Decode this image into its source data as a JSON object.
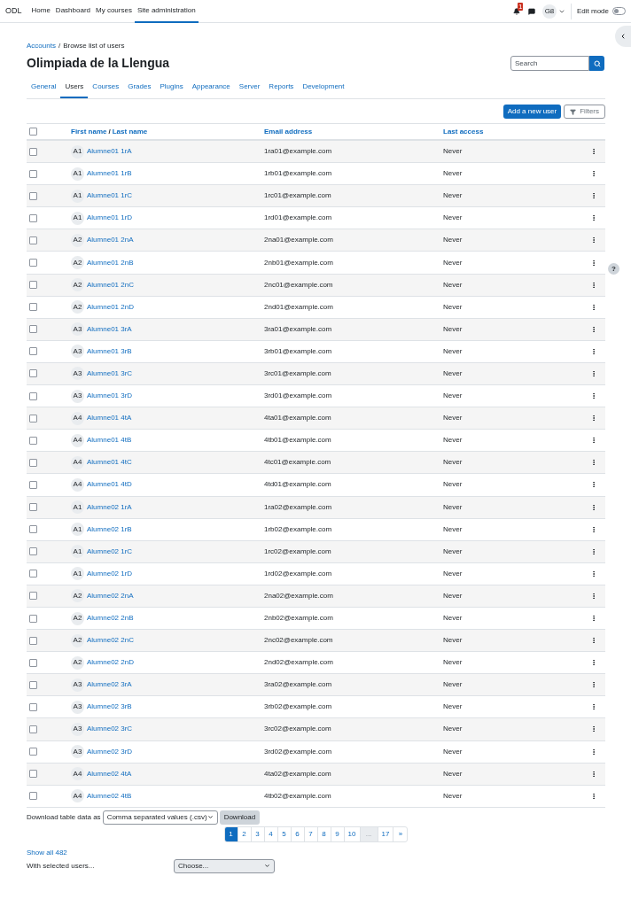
{
  "navbar": {
    "brand": "ODL",
    "links": [
      {
        "label": "Home",
        "selected": false
      },
      {
        "label": "Dashboard",
        "selected": false
      },
      {
        "label": "My courses",
        "selected": false
      },
      {
        "label": "Site administration",
        "selected": true
      }
    ],
    "notification_count": "1",
    "user_initials": "G8",
    "edit_mode": {
      "label": "Edit mode",
      "on": false
    }
  },
  "breadcrumb": [
    {
      "label": "Accounts",
      "kind": "link"
    },
    {
      "label": "/",
      "kind": "separator"
    },
    {
      "label": "Browse list of users",
      "kind": "current"
    }
  ],
  "help": "?",
  "title": "Olimpiada de la Llengua",
  "search": {
    "placeholder": "Search"
  },
  "tabs": [
    {
      "label": "General",
      "selected": false
    },
    {
      "label": "Users",
      "selected": true
    },
    {
      "label": "Courses",
      "selected": false
    },
    {
      "label": "Grades",
      "selected": false
    },
    {
      "label": "Plugins",
      "selected": false
    },
    {
      "label": "Appearance",
      "selected": false
    },
    {
      "label": "Server",
      "selected": false
    },
    {
      "label": "Reports",
      "selected": false
    },
    {
      "label": "Development",
      "selected": false
    }
  ],
  "actions": {
    "add_user": "Add a new user",
    "filters": "Filters"
  },
  "table": {
    "select_all_checked": false,
    "columns": {
      "first_name": "First name",
      "name_separator": "/",
      "last_name": "Last name",
      "email": "Email address",
      "last_access": "Last access"
    },
    "rows": [
      {
        "avatar": "A1",
        "name": "Alumne01 1rA",
        "email": "1ra01@example.com",
        "last_access": "Never",
        "checked": false
      },
      {
        "avatar": "A1",
        "name": "Alumne01 1rB",
        "email": "1rb01@example.com",
        "last_access": "Never",
        "checked": false
      },
      {
        "avatar": "A1",
        "name": "Alumne01 1rC",
        "email": "1rc01@example.com",
        "last_access": "Never",
        "checked": false
      },
      {
        "avatar": "A1",
        "name": "Alumne01 1rD",
        "email": "1rd01@example.com",
        "last_access": "Never",
        "checked": false
      },
      {
        "avatar": "A2",
        "name": "Alumne01 2nA",
        "email": "2na01@example.com",
        "last_access": "Never",
        "checked": false
      },
      {
        "avatar": "A2",
        "name": "Alumne01 2nB",
        "email": "2nb01@example.com",
        "last_access": "Never",
        "checked": false
      },
      {
        "avatar": "A2",
        "name": "Alumne01 2nC",
        "email": "2nc01@example.com",
        "last_access": "Never",
        "checked": false
      },
      {
        "avatar": "A2",
        "name": "Alumne01 2nD",
        "email": "2nd01@example.com",
        "last_access": "Never",
        "checked": false
      },
      {
        "avatar": "A3",
        "name": "Alumne01 3rA",
        "email": "3ra01@example.com",
        "last_access": "Never",
        "checked": false
      },
      {
        "avatar": "A3",
        "name": "Alumne01 3rB",
        "email": "3rb01@example.com",
        "last_access": "Never",
        "checked": false
      },
      {
        "avatar": "A3",
        "name": "Alumne01 3rC",
        "email": "3rc01@example.com",
        "last_access": "Never",
        "checked": false
      },
      {
        "avatar": "A3",
        "name": "Alumne01 3rD",
        "email": "3rd01@example.com",
        "last_access": "Never",
        "checked": false
      },
      {
        "avatar": "A4",
        "name": "Alumne01 4tA",
        "email": "4ta01@example.com",
        "last_access": "Never",
        "checked": false
      },
      {
        "avatar": "A4",
        "name": "Alumne01 4tB",
        "email": "4tb01@example.com",
        "last_access": "Never",
        "checked": false
      },
      {
        "avatar": "A4",
        "name": "Alumne01 4tC",
        "email": "4tc01@example.com",
        "last_access": "Never",
        "checked": false
      },
      {
        "avatar": "A4",
        "name": "Alumne01 4tD",
        "email": "4td01@example.com",
        "last_access": "Never",
        "checked": false
      },
      {
        "avatar": "A1",
        "name": "Alumne02 1rA",
        "email": "1ra02@example.com",
        "last_access": "Never",
        "checked": false
      },
      {
        "avatar": "A1",
        "name": "Alumne02 1rB",
        "email": "1rb02@example.com",
        "last_access": "Never",
        "checked": false
      },
      {
        "avatar": "A1",
        "name": "Alumne02 1rC",
        "email": "1rc02@example.com",
        "last_access": "Never",
        "checked": false
      },
      {
        "avatar": "A1",
        "name": "Alumne02 1rD",
        "email": "1rd02@example.com",
        "last_access": "Never",
        "checked": false
      },
      {
        "avatar": "A2",
        "name": "Alumne02 2nA",
        "email": "2na02@example.com",
        "last_access": "Never",
        "checked": false
      },
      {
        "avatar": "A2",
        "name": "Alumne02 2nB",
        "email": "2nb02@example.com",
        "last_access": "Never",
        "checked": false
      },
      {
        "avatar": "A2",
        "name": "Alumne02 2nC",
        "email": "2nc02@example.com",
        "last_access": "Never",
        "checked": false
      },
      {
        "avatar": "A2",
        "name": "Alumne02 2nD",
        "email": "2nd02@example.com",
        "last_access": "Never",
        "checked": false
      },
      {
        "avatar": "A3",
        "name": "Alumne02 3rA",
        "email": "3ra02@example.com",
        "last_access": "Never",
        "checked": false
      },
      {
        "avatar": "A3",
        "name": "Alumne02 3rB",
        "email": "3rb02@example.com",
        "last_access": "Never",
        "checked": false
      },
      {
        "avatar": "A3",
        "name": "Alumne02 3rC",
        "email": "3rc02@example.com",
        "last_access": "Never",
        "checked": false
      },
      {
        "avatar": "A3",
        "name": "Alumne02 3rD",
        "email": "3rd02@example.com",
        "last_access": "Never",
        "checked": false
      },
      {
        "avatar": "A4",
        "name": "Alumne02 4tA",
        "email": "4ta02@example.com",
        "last_access": "Never",
        "checked": false
      },
      {
        "avatar": "A4",
        "name": "Alumne02 4tB",
        "email": "4tb02@example.com",
        "last_access": "Never",
        "checked": false
      }
    ]
  },
  "download": {
    "label": "Download table data as",
    "format": "Comma separated values (.csv)",
    "button": "Download"
  },
  "pagination": [
    {
      "label": "1",
      "kind": "page",
      "selected": true
    },
    {
      "label": "2",
      "kind": "page",
      "selected": false
    },
    {
      "label": "3",
      "kind": "page",
      "selected": false
    },
    {
      "label": "4",
      "kind": "page",
      "selected": false
    },
    {
      "label": "5",
      "kind": "page",
      "selected": false
    },
    {
      "label": "6",
      "kind": "page",
      "selected": false
    },
    {
      "label": "7",
      "kind": "page",
      "selected": false
    },
    {
      "label": "8",
      "kind": "page",
      "selected": false
    },
    {
      "label": "9",
      "kind": "page",
      "selected": false
    },
    {
      "label": "10",
      "kind": "page",
      "selected": false
    },
    {
      "label": "...",
      "kind": "gap"
    },
    {
      "label": "17",
      "kind": "page",
      "selected": false
    },
    {
      "label": "»",
      "kind": "page",
      "selected": false
    }
  ],
  "show_all": "Show all 482",
  "bulk": {
    "label": "With selected users...",
    "value": "Choose..."
  }
}
